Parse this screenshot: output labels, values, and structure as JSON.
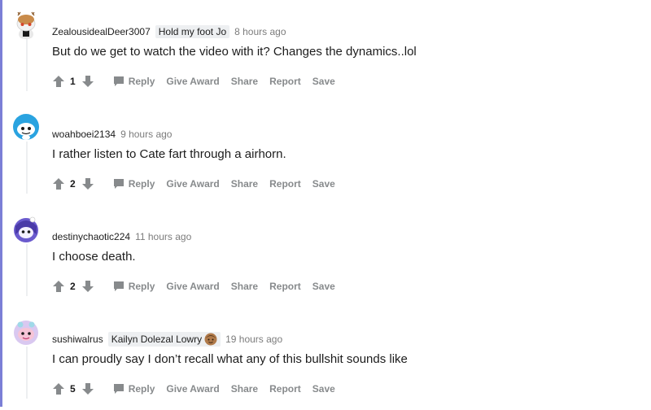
{
  "comments": [
    {
      "username": "ZealousidealDeer3007",
      "flair": "Hold my foot Jo",
      "time": "8 hours ago",
      "body": "But do we get to watch the video with it? Changes the dynamics..lol",
      "score": "1",
      "avatar_icon": "snoo-deer-avatar-icon"
    },
    {
      "username": "woahboei2134",
      "time": "9 hours ago",
      "body": "I rather listen to Cate fart through a airhorn.",
      "score": "2",
      "avatar_icon": "snoo-blue-avatar-icon"
    },
    {
      "username": "destinychaotic224",
      "time": "11 hours ago",
      "body": "I choose death.",
      "score": "2",
      "avatar_icon": "snoo-purple-avatar-icon"
    },
    {
      "username": "sushiwalrus",
      "flair": "Kailyn Dolezal Lowry",
      "flair_emoji": "face-emoji-icon",
      "time": "19 hours ago",
      "body": "I can proudly say I don’t recall what any of this bullshit sounds like",
      "score": "5",
      "avatar_icon": "snoo-pink-avatar-icon"
    }
  ],
  "actions": {
    "reply": "Reply",
    "give_award": "Give Award",
    "share": "Share",
    "report": "Report",
    "save": "Save"
  },
  "colors": {
    "accent_left_rule": "#7b7fd6",
    "action_gray": "#878a8c",
    "flair_bg": "#edeff1"
  }
}
